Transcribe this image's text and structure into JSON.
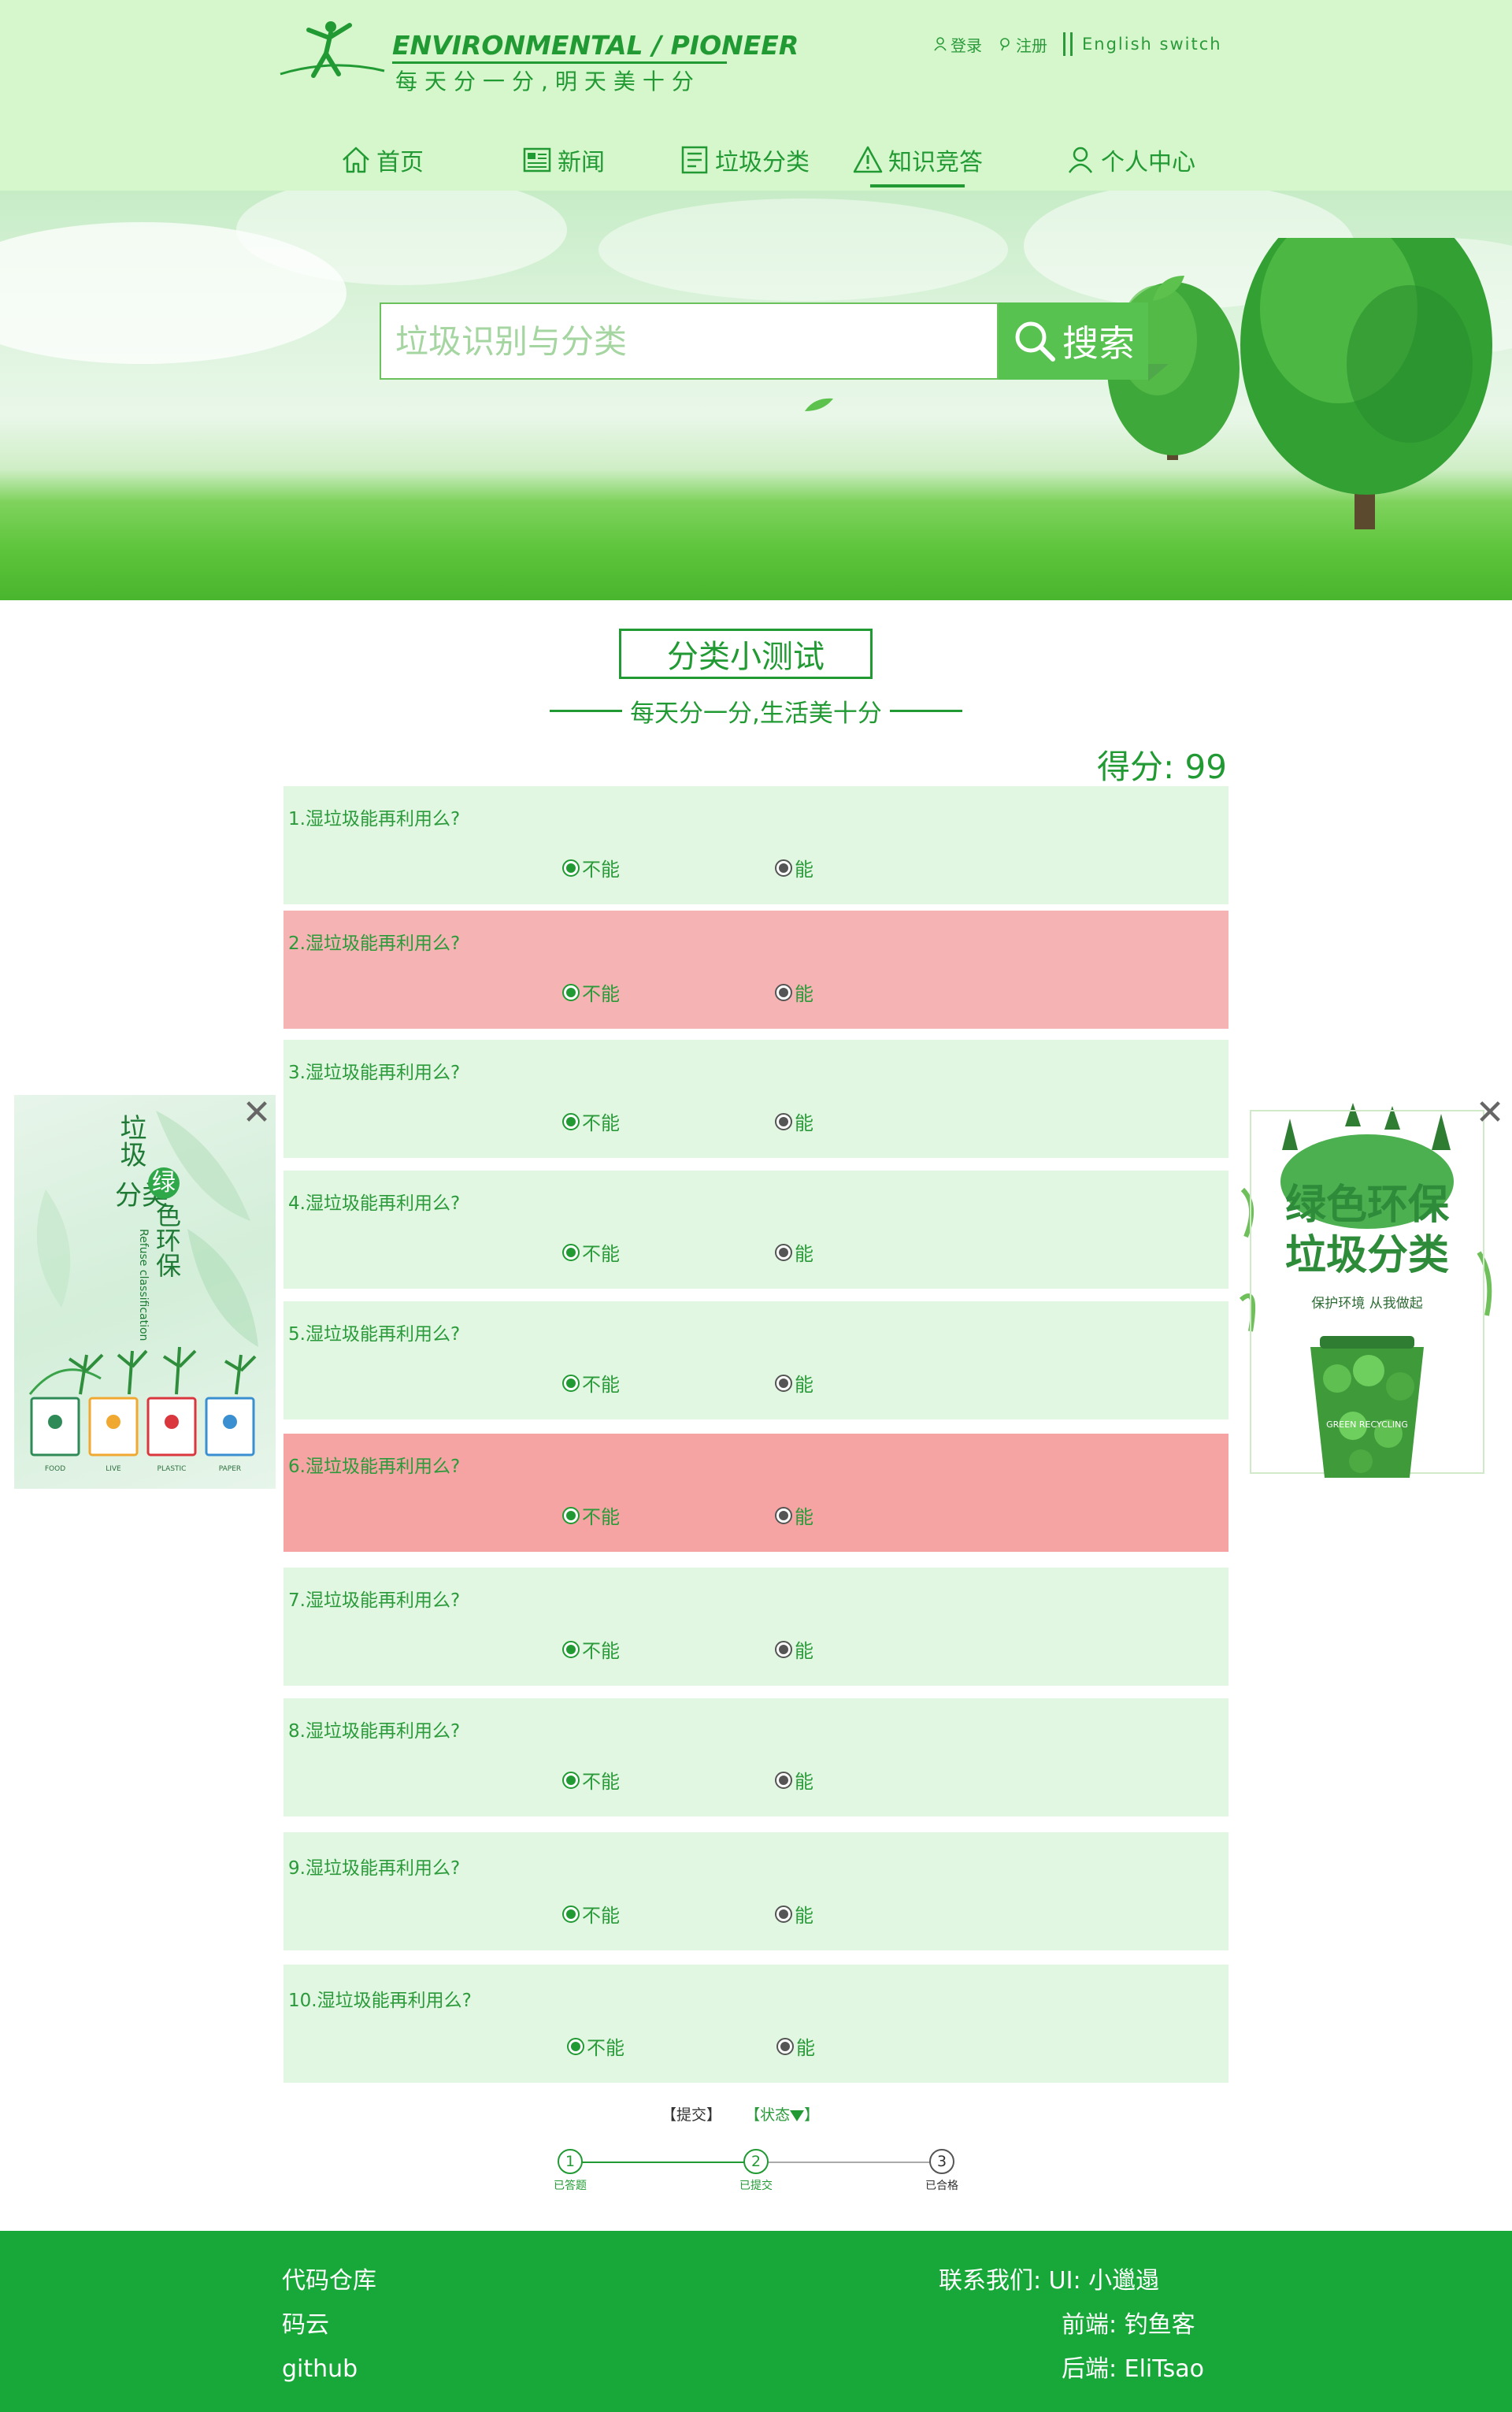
{
  "logo": {
    "title": "ENVIRONMENTAL / PIONEER",
    "slogan": "每天分一分,明天美十分"
  },
  "toplinks": {
    "login": "登录",
    "register": "注册",
    "language": "English switch"
  },
  "nav": {
    "items": [
      {
        "label": "首页",
        "icon": "home-icon"
      },
      {
        "label": "新闻",
        "icon": "news-icon"
      },
      {
        "label": "垃圾分类",
        "icon": "list-icon"
      },
      {
        "label": "知识竞答",
        "icon": "warning-icon",
        "active": true
      },
      {
        "label": "个人中心",
        "icon": "user-icon"
      }
    ]
  },
  "search": {
    "placeholder": "垃圾识别与分类",
    "button": "搜索"
  },
  "quiz": {
    "title": "分类小测试",
    "slogan": "每天分一分,生活美十分",
    "score_label": "得分:",
    "score": "99",
    "questions": [
      {
        "text": "1.湿垃圾能再利用么?",
        "opt1": "不能",
        "opt2": "能",
        "state": "normal"
      },
      {
        "text": "2.湿垃圾能再利用么?",
        "opt1": "不能",
        "opt2": "能",
        "state": "wrong"
      },
      {
        "text": "3.湿垃圾能再利用么?",
        "opt1": "不能",
        "opt2": "能",
        "state": "normal"
      },
      {
        "text": "4.湿垃圾能再利用么?",
        "opt1": "不能",
        "opt2": "能",
        "state": "normal"
      },
      {
        "text": "5.湿垃圾能再利用么?",
        "opt1": "不能",
        "opt2": "能",
        "state": "normal"
      },
      {
        "text": "6.湿垃圾能再利用么?",
        "opt1": "不能",
        "opt2": "能",
        "state": "wrong"
      },
      {
        "text": "7.湿垃圾能再利用么?",
        "opt1": "不能",
        "opt2": "能",
        "state": "normal"
      },
      {
        "text": "8.湿垃圾能再利用么?",
        "opt1": "不能",
        "opt2": "能",
        "state": "normal"
      },
      {
        "text": "9.湿垃圾能再利用么?",
        "opt1": "不能",
        "opt2": "能",
        "state": "normal"
      },
      {
        "text": "10.湿垃圾能再利用么?",
        "opt1": "不能",
        "opt2": "能",
        "state": "normal"
      }
    ],
    "submit": "【提交】",
    "status": "【状态",
    "status_close": "】",
    "steps": [
      {
        "num": "1",
        "label": "已答题"
      },
      {
        "num": "2",
        "label": "已提交"
      },
      {
        "num": "3",
        "label": "已合格"
      }
    ]
  },
  "ads": {
    "left": {
      "title_a": "垃圾",
      "title_b": "分类",
      "title_c": "绿",
      "title_d": "色环保",
      "subtitle": "Refuse classification",
      "bins": [
        "FOOD",
        "LIVE",
        "PLASTIC",
        "PAPER"
      ]
    },
    "right": {
      "line1": "绿色环保",
      "line2": "垃圾分类",
      "line3": "保护环境 从我做起",
      "cup": "GREEN RECYCLING"
    },
    "close": "✕"
  },
  "footer": {
    "repo_title": "代码仓库",
    "repo1": "码云",
    "repo2": "github",
    "contact": "联系我们: UI: 小邋遢",
    "frontend": "前端: 钓鱼客",
    "backend": "后端: EliTsao"
  }
}
